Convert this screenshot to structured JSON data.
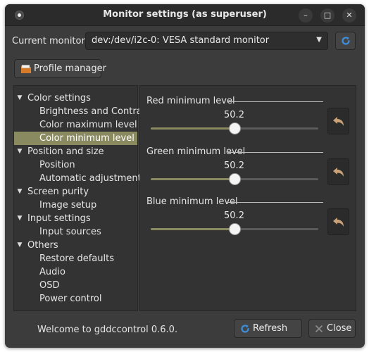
{
  "window": {
    "title": "Monitor settings (as superuser)"
  },
  "monitor": {
    "label": "Current monitor:",
    "selected": "dev:/dev/i2c-0: VESA standard monitor"
  },
  "toolbar": {
    "profile_manager_label": "Profile manager"
  },
  "tree": {
    "items": [
      {
        "label": "Color settings",
        "level": 0,
        "expanded": true
      },
      {
        "label": "Brightness and Contrast",
        "level": 1
      },
      {
        "label": "Color maximum level",
        "level": 1
      },
      {
        "label": "Color minimum level",
        "level": 1,
        "selected": true
      },
      {
        "label": "Position and size",
        "level": 0,
        "expanded": true
      },
      {
        "label": "Position",
        "level": 1
      },
      {
        "label": "Automatic adjustments",
        "level": 1
      },
      {
        "label": "Screen purity",
        "level": 0,
        "expanded": true
      },
      {
        "label": "Image setup",
        "level": 1
      },
      {
        "label": "Input settings",
        "level": 0,
        "expanded": true
      },
      {
        "label": "Input sources",
        "level": 1
      },
      {
        "label": "Others",
        "level": 0,
        "expanded": true
      },
      {
        "label": "Restore defaults",
        "level": 1
      },
      {
        "label": "Audio",
        "level": 1
      },
      {
        "label": "OSD",
        "level": 1
      },
      {
        "label": "Power control",
        "level": 1
      }
    ]
  },
  "controls": [
    {
      "title": "Red minimum level",
      "value": "50.2",
      "fraction": 0.502
    },
    {
      "title": "Green minimum level",
      "value": "50.2",
      "fraction": 0.502
    },
    {
      "title": "Blue minimum level",
      "value": "50.2",
      "fraction": 0.502
    }
  ],
  "footer": {
    "status": "Welcome to gddccontrol 0.6.0.",
    "refresh_label": "Refresh",
    "close_label": "Close"
  },
  "colors": {
    "window_bg": "#3c3c3c",
    "titlebar_bg": "#2b2b2b",
    "panel_bg": "#333333",
    "accent": "#8a8a60",
    "refresh_icon": "#3d8fe0",
    "undo_icon": "#c9a27a",
    "folder_icon": "#e08a3a"
  },
  "icons": {
    "app": "app-icon",
    "minimize": "minimize-icon",
    "maximize": "maximize-icon",
    "close": "close-icon",
    "refresh": "refresh-icon",
    "profile": "folder-icon",
    "undo": "undo-icon",
    "expander": "triangle-down-icon"
  }
}
